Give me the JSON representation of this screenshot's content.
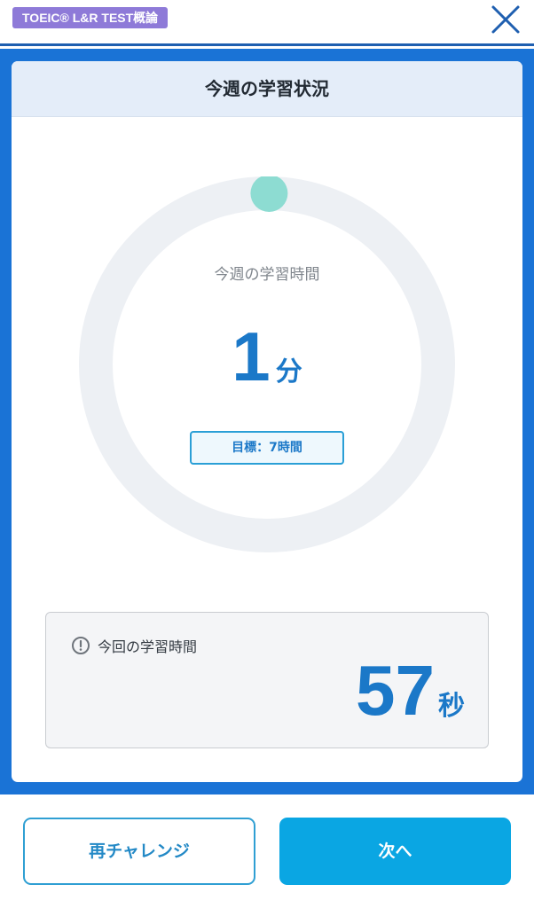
{
  "header": {
    "course_badge": "TOEIC® L&R TEST概論",
    "close_icon": "close-icon"
  },
  "card": {
    "title": "今週の学習状況",
    "weekly": {
      "label": "今週の学習時間",
      "value": "1",
      "unit": "分",
      "goal": "目標：7時間",
      "progress_fraction": 0.002
    },
    "session": {
      "icon": "clock-icon",
      "label": "今回の学習時間",
      "value": "57",
      "unit": "秒"
    }
  },
  "footer": {
    "retry_label": "再チャレンジ",
    "next_label": "次へ"
  },
  "colors": {
    "accent_blue": "#1a73d6",
    "value_blue": "#1b78c8",
    "button_blue": "#0aa6e3",
    "progress_teal": "#8ddcd2",
    "badge_purple": "#8e7ad8"
  }
}
